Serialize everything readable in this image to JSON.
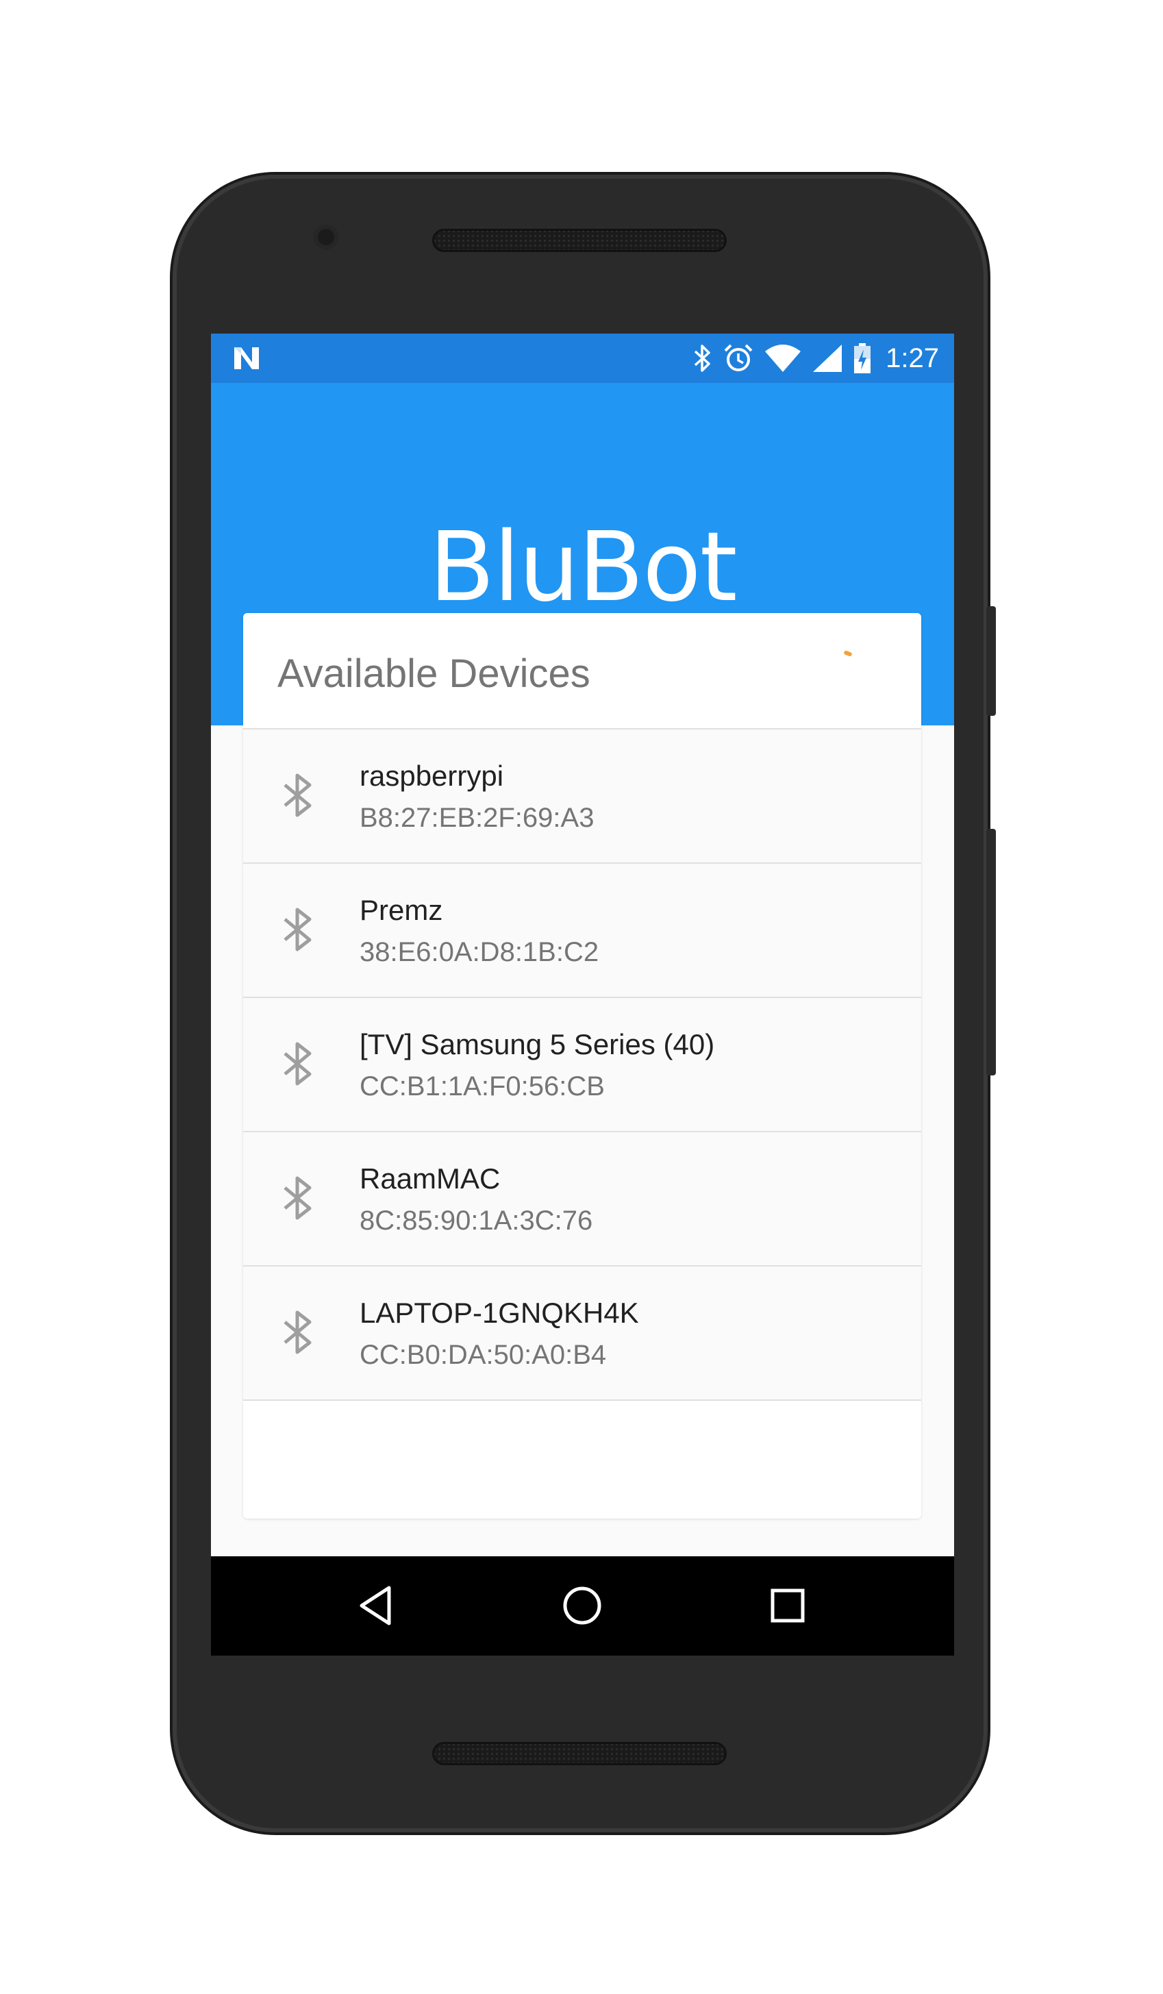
{
  "status_bar": {
    "time": "1:27",
    "icons": [
      "notification-n-icon",
      "bluetooth-icon",
      "alarm-icon",
      "wifi-icon",
      "signal-icon",
      "battery-icon"
    ]
  },
  "app": {
    "title": "BluBot"
  },
  "card": {
    "title": "Available Devices"
  },
  "devices": [
    {
      "name": "raspberrypi",
      "address": "B8:27:EB:2F:69:A3"
    },
    {
      "name": "Premz",
      "address": "38:E6:0A:D8:1B:C2"
    },
    {
      "name": "[TV] Samsung 5 Series (40)",
      "address": "CC:B1:1A:F0:56:CB"
    },
    {
      "name": "RaamMAC",
      "address": "8C:85:90:1A:3C:76"
    },
    {
      "name": "LAPTOP-1GNQKH4K",
      "address": "CC:B0:DA:50:A0:B4"
    }
  ],
  "nav_bar": {
    "buttons": [
      "back-icon",
      "home-icon",
      "recents-icon"
    ]
  },
  "colors": {
    "status_bar": "#1e80dc",
    "app_bar": "#2196f3",
    "spinner": "#f2a33a"
  }
}
